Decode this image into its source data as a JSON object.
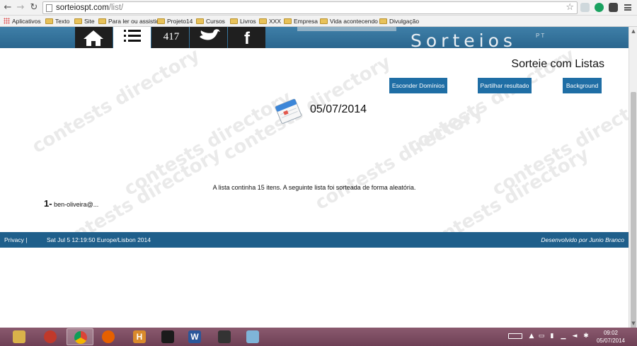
{
  "browser": {
    "url_host": "sorteiospt.com",
    "url_path": "/list/",
    "bookmarks": [
      "Aplicativos",
      "Texto",
      "Site",
      "Para ler ou assistir",
      "Projeto14",
      "Cursos",
      "Livros",
      "XXX",
      "Empresa",
      "Vida acontecendo",
      "Divulgação"
    ]
  },
  "site": {
    "brand": "Sorteios",
    "brand_suffix": "PT",
    "nav": [
      {
        "icon": "home-icon"
      },
      {
        "icon": "list-icon"
      },
      {
        "icon": "numbers-icon",
        "label": "417"
      },
      {
        "icon": "twitter-bird-icon"
      },
      {
        "icon": "facebook-icon",
        "label": "f"
      }
    ]
  },
  "page": {
    "title": "Sorteie com Listas",
    "buttons": {
      "hide_domains": "Esconder Domínios",
      "share": "Partilhar resultado",
      "background": "Background"
    },
    "date": "05/07/2014",
    "summary": "A lista continha 15 itens. A seguinte lista foi sorteada de forma aleatória.",
    "results": [
      {
        "number": "1-",
        "value": "ben-oliveira@..."
      }
    ],
    "watermark": "contests directory"
  },
  "footer": {
    "privacy": "Privacy |",
    "datetime": "Sat Jul 5 12:19:50 Europe/Lisbon 2014",
    "credit": "Desenvolvido por Junio Branco"
  },
  "taskbar": {
    "time": "09:02",
    "date": "05/07/2014"
  },
  "colors": {
    "header_blue": "#2a668e",
    "button_blue": "#1f6ea5",
    "footer_blue": "#1f5f8b",
    "taskbar": "#7a4a60"
  }
}
